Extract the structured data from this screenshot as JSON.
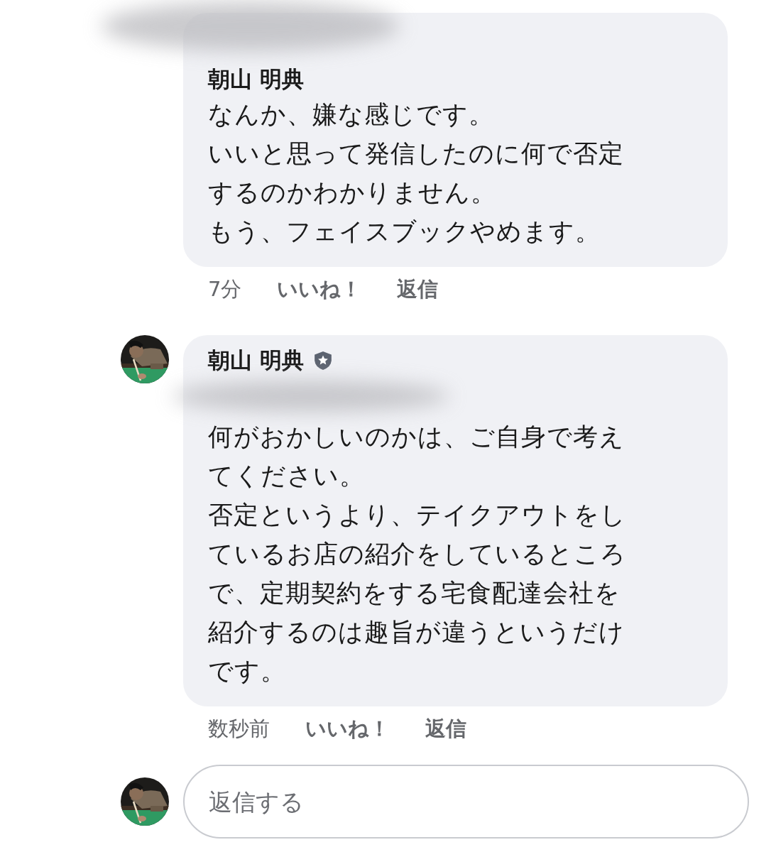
{
  "comments": [
    {
      "author": "朝山 明典",
      "badge": false,
      "blurred_above_name": true,
      "blurred_below_name": false,
      "lines": [
        "なんか、嫌な感じです。",
        "いいと思って発信したのに何で否定",
        "するのかわかりません。",
        "もう、フェイスブックやめます。"
      ],
      "time": "7分",
      "like": "いいね！",
      "reply": "返信"
    },
    {
      "author": "朝山 明典",
      "badge": true,
      "blurred_above_name": false,
      "blurred_below_name": true,
      "lines": [
        "何がおかしいのかは、ご自身で考え",
        "てください。",
        "否定というより、テイクアウトをし",
        "ているお店の紹介をしているところ",
        "で、定期契約をする宅食配達会社を",
        "紹介するのは趣旨が違うというだけ",
        "です。"
      ],
      "time": "数秒前",
      "like": "いいね！",
      "reply": "返信"
    }
  ],
  "reply_box": {
    "placeholder": "返信する"
  }
}
